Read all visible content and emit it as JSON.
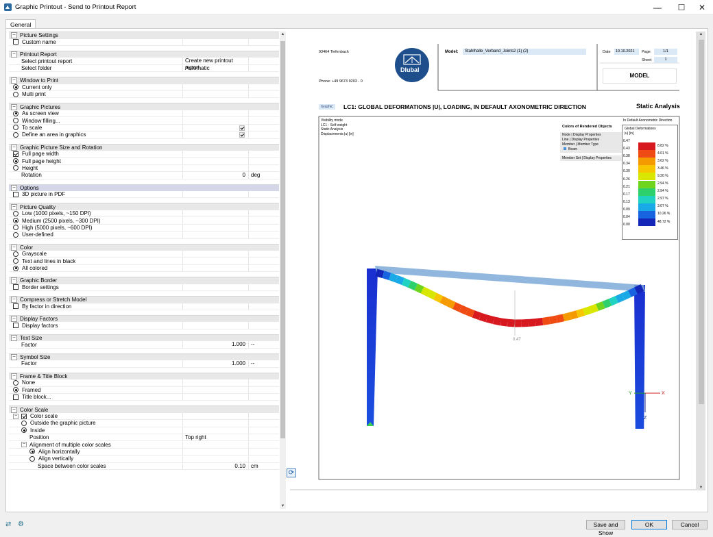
{
  "window": {
    "title": "Graphic Printout - Send to Printout Report"
  },
  "tabs": [
    {
      "label": "General"
    }
  ],
  "tree": [
    {
      "type": "section",
      "label": "Picture Settings"
    },
    {
      "type": "row",
      "label": "Custom name",
      "control": "checkbox",
      "checked": false
    },
    {
      "type": "spacer"
    },
    {
      "type": "section",
      "label": "Printout Report"
    },
    {
      "type": "row",
      "label": "Select printout report",
      "value": "Create new printout report"
    },
    {
      "type": "row",
      "label": "Select folder",
      "value": "Automatic"
    },
    {
      "type": "spacer"
    },
    {
      "type": "section",
      "label": "Window to Print"
    },
    {
      "type": "row",
      "label": "Current only",
      "control": "radio",
      "checked": true
    },
    {
      "type": "row",
      "label": "Multi print",
      "control": "radio",
      "checked": false
    },
    {
      "type": "spacer"
    },
    {
      "type": "section",
      "label": "Graphic Pictures"
    },
    {
      "type": "row",
      "label": "As screen view",
      "control": "radio",
      "checked": true
    },
    {
      "type": "row",
      "label": "Window filling...",
      "control": "radio",
      "checked": false
    },
    {
      "type": "row",
      "label": "To scale",
      "control": "radio",
      "checked": false,
      "side_check": true
    },
    {
      "type": "row",
      "label": "Define an area in graphics",
      "control": "radio",
      "checked": false,
      "side_check": true
    },
    {
      "type": "spacer"
    },
    {
      "type": "section",
      "label": "Graphic Picture Size and Rotation"
    },
    {
      "type": "row",
      "label": "Full page width",
      "control": "checkbox",
      "checked": true
    },
    {
      "type": "row",
      "label": "Full page height",
      "control": "radio",
      "checked": true
    },
    {
      "type": "row",
      "label": "Height",
      "control": "radio",
      "checked": false
    },
    {
      "type": "row",
      "label": "Rotation",
      "value": "0",
      "unit": "deg",
      "numeric": true,
      "plain": true
    },
    {
      "type": "spacer"
    },
    {
      "type": "section",
      "label": "Options",
      "highlight": true
    },
    {
      "type": "row",
      "label": "3D picture in PDF",
      "control": "checkbox",
      "checked": false
    },
    {
      "type": "spacer"
    },
    {
      "type": "section",
      "label": "Picture Quality"
    },
    {
      "type": "row",
      "label": "Low (1000 pixels, ~150 DPI)",
      "control": "radio",
      "checked": false
    },
    {
      "type": "row",
      "label": "Medium (2500 pixels, ~300 DPI)",
      "control": "radio",
      "checked": true
    },
    {
      "type": "row",
      "label": "High (5000 pixels, ~600 DPI)",
      "control": "radio",
      "checked": false
    },
    {
      "type": "row",
      "label": "User-defined",
      "control": "radio",
      "checked": false
    },
    {
      "type": "spacer"
    },
    {
      "type": "section",
      "label": "Color"
    },
    {
      "type": "row",
      "label": "Grayscale",
      "control": "radio",
      "checked": false
    },
    {
      "type": "row",
      "label": "Text and lines in black",
      "control": "radio",
      "checked": false
    },
    {
      "type": "row",
      "label": "All colored",
      "control": "radio",
      "checked": true
    },
    {
      "type": "spacer"
    },
    {
      "type": "section",
      "label": "Graphic Border"
    },
    {
      "type": "row",
      "label": "Border settings",
      "control": "checkbox",
      "checked": false
    },
    {
      "type": "spacer"
    },
    {
      "type": "section",
      "label": "Compress or Stretch Model"
    },
    {
      "type": "row",
      "label": "By factor in direction",
      "control": "checkbox",
      "checked": false
    },
    {
      "type": "spacer"
    },
    {
      "type": "section",
      "label": "Display Factors"
    },
    {
      "type": "row",
      "label": "Display factors",
      "control": "checkbox",
      "checked": false
    },
    {
      "type": "spacer"
    },
    {
      "type": "section",
      "label": "Text Size"
    },
    {
      "type": "row",
      "label": "Factor",
      "value": "1.000",
      "unit": "--",
      "numeric": true,
      "plain": true
    },
    {
      "type": "spacer"
    },
    {
      "type": "section",
      "label": "Symbol Size"
    },
    {
      "type": "row",
      "label": "Factor",
      "value": "1.000",
      "unit": "--",
      "numeric": true,
      "plain": true
    },
    {
      "type": "spacer"
    },
    {
      "type": "section",
      "label": "Frame & Title Block"
    },
    {
      "type": "row",
      "label": "None",
      "control": "radio",
      "checked": false
    },
    {
      "type": "row",
      "label": "Framed",
      "control": "radio",
      "checked": true
    },
    {
      "type": "row",
      "label": "Title block...",
      "control": "checkbox",
      "checked": false
    },
    {
      "type": "spacer"
    },
    {
      "type": "section",
      "label": "Color Scale"
    },
    {
      "type": "row",
      "label": "Color scale",
      "control": "checkbox",
      "checked": true,
      "expander": true
    },
    {
      "type": "row",
      "label": "Outside the graphic picture",
      "control": "radio",
      "checked": false,
      "indent": 1
    },
    {
      "type": "row",
      "label": "Inside",
      "control": "radio",
      "checked": true,
      "indent": 1
    },
    {
      "type": "row",
      "label": "Position",
      "value": "Top right",
      "plain": true,
      "indent": 1
    },
    {
      "type": "row",
      "label": "Alignment of multiple color scales",
      "expander": true,
      "indent": 1,
      "plain": true
    },
    {
      "type": "row",
      "label": "Align horizontally",
      "control": "radio",
      "checked": true,
      "indent": 2
    },
    {
      "type": "row",
      "label": "Align vertically",
      "control": "radio",
      "checked": false,
      "indent": 2
    },
    {
      "type": "row",
      "label": "Space between color scales",
      "value": "0.10",
      "unit": "cm",
      "numeric": true,
      "plain": true,
      "indent": 2
    }
  ],
  "report": {
    "company_city": "93464 Tiefenbach",
    "phone": "Phone: +49 9673 9203 - 0",
    "logo_text": "Dlubal",
    "model_label": "Model:",
    "model_value": "Stahlhalle_Verband_Joints2 (1) (2)",
    "date_label": "Date",
    "date_value": "19.10.2021",
    "page_label": "Page",
    "page_value": "1/1",
    "sheet_label": "Sheet",
    "sheet_value": "1",
    "model_box": "MODEL",
    "badge": "Graphic",
    "heading": "LC1: GLOBAL DEFORMATIONS |U|, LOADING, IN DEFAULT AXONOMETRIC DIRECTION",
    "heading_right": "Static Analysis",
    "info_lines": [
      "Visibility mode",
      "LC1 - Self-weight",
      "Static Analysis",
      "Displacements |u| [in]"
    ],
    "direction": "In Default Axonometric Direction",
    "colors_title": "Colors of Rendered Objects",
    "colors_lines": [
      "Node | Display Properties",
      "Line | Display Properties",
      "Member | Member Type"
    ],
    "colors_beam": "Beam",
    "colors_member_set": "Member Set | Display Properties",
    "legend_title": "Global Deformations",
    "legend_unit": "|u| [in]",
    "max_label": "0.47",
    "axis_y": "Y",
    "axis_x": "X",
    "axis_z": "Z"
  },
  "legend": {
    "values": [
      "0.47",
      "0.43",
      "0.38",
      "0.34",
      "0.30",
      "0.26",
      "0.21",
      "0.17",
      "0.13",
      "0.09",
      "0.04",
      "0.00"
    ],
    "percents": [
      "8.82 %",
      "4.01 %",
      "3.62 %",
      "3.46 %",
      "9.20 %",
      "2.94 %",
      "2.94 %",
      "2.97 %",
      "3.07 %",
      "10.26 %",
      "48.72 %"
    ],
    "colors": [
      "#d7181e",
      "#f04b12",
      "#f59a00",
      "#f8c600",
      "#d9e600",
      "#6ed41d",
      "#2dd06a",
      "#1fd2c2",
      "#19a9e6",
      "#1863e0",
      "#1426b8"
    ]
  },
  "buttons": {
    "save_show": "Save and Show",
    "ok": "OK",
    "cancel": "Cancel"
  },
  "window_controls": {
    "minimize": "—",
    "maximize": "☐",
    "close": "✕"
  }
}
